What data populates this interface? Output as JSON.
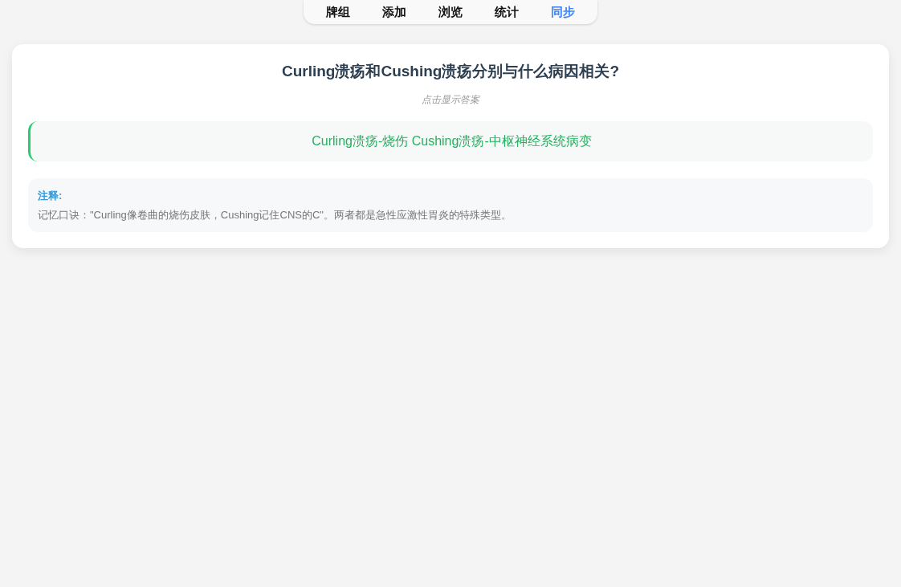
{
  "tabs": [
    {
      "label": "牌组",
      "selected": false
    },
    {
      "label": "添加",
      "selected": false
    },
    {
      "label": "浏览",
      "selected": false
    },
    {
      "label": "统计",
      "selected": false
    },
    {
      "label": "同步",
      "selected": true
    }
  ],
  "card": {
    "question": "Curling溃疡和Cushing溃疡分别与什么病因相关?",
    "hint": "点击显示答案",
    "answer": "Curling溃疡-烧伤 Cushing溃疡-中枢神经系统病变",
    "note_title": "注释:",
    "note": "记忆口诀：\"Curling像卷曲的烧伤皮肤，Cushing记住CNS的C\"。两者都是急性应激性胃炎的特殊类型。"
  }
}
